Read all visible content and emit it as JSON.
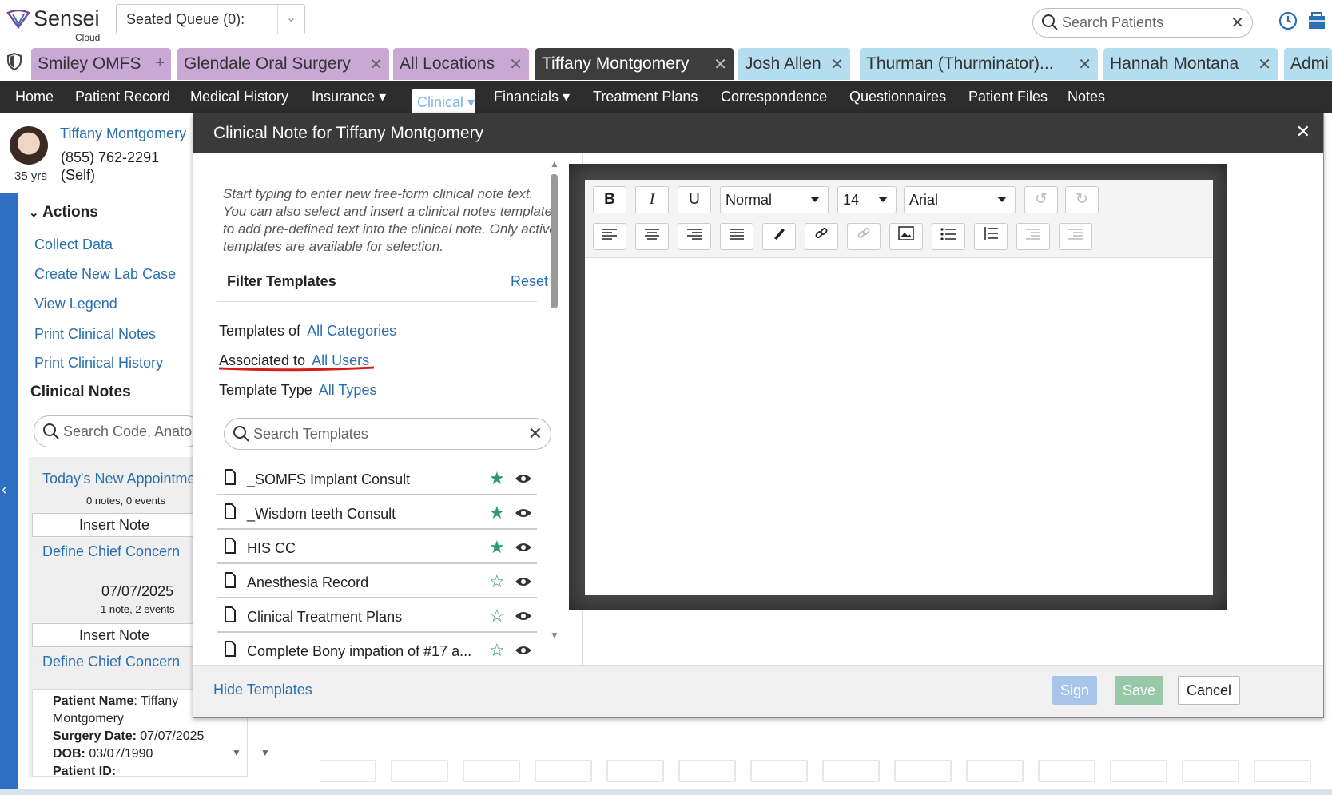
{
  "app": {
    "logo_name": "Sensei",
    "logo_sub": "Cloud"
  },
  "queue": {
    "label": "Seated Queue (0):"
  },
  "patient_search": {
    "placeholder": "Search Patients"
  },
  "tabs": [
    {
      "label": "Smiley OMFS",
      "action": "+"
    },
    {
      "label": "Glendale Oral Surgery",
      "action": "✕"
    },
    {
      "label": "All Locations",
      "action": "✕"
    },
    {
      "label": "Tiffany Montgomery",
      "action": "✕"
    },
    {
      "label": "Josh Allen",
      "action": "✕"
    },
    {
      "label": "Thurman (Thurminator)...",
      "action": "✕"
    },
    {
      "label": "Hannah Montana",
      "action": "✕"
    },
    {
      "label": "Admi",
      "action": ""
    }
  ],
  "nav": [
    "Home",
    "Patient Record",
    "Medical History",
    "Insurance",
    "Clinical",
    "Financials",
    "Treatment Plans",
    "Correspondence",
    "Questionnaires",
    "Patient Files",
    "Notes"
  ],
  "patient": {
    "name": "Tiffany Montgomery",
    "age": "35 yrs",
    "phone": "(855) 762-2291",
    "relation": "(Self)"
  },
  "actions": {
    "title": "Actions",
    "items": [
      "Collect Data",
      "Create New Lab Case",
      "View Legend",
      "Print Clinical Notes",
      "Print Clinical History"
    ]
  },
  "clinical_notes": {
    "title": "Clinical Notes",
    "search_placeholder": "Search Code, Anatomy",
    "groups": [
      {
        "title": "Today's New Appointment",
        "meta": "0 notes,  0 events",
        "insert": "Insert Note",
        "define": "Define Chief Concern"
      },
      {
        "title": "07/07/2025",
        "meta": "1 note,  2 events",
        "insert": "Insert Note",
        "define": "Define Chief Concern"
      }
    ],
    "info": {
      "name_label": "Patient Name",
      "name_value": ": Tiffany Montgomery",
      "surgery_label": "Surgery Date:",
      "surgery_value": " 07/07/2025",
      "dob_label": "DOB:",
      "dob_value": " 03/07/1990",
      "pid_label": "Patient ID:"
    }
  },
  "modal": {
    "title": "Clinical Note for Tiffany Montgomery",
    "help_text": "Start typing to enter new free-form clinical note text. You can also select and insert a clinical notes template to add pre-defined text into the clinical note. Only active templates are available for selection.",
    "filter_title": "Filter Templates",
    "reset": "Reset",
    "filters": [
      {
        "label": "Templates of",
        "value": "All Categories"
      },
      {
        "label": "Associated to",
        "value": "All Users"
      },
      {
        "label": "Template Type",
        "value": "All Types"
      }
    ],
    "template_search_placeholder": "Search Templates",
    "templates": [
      {
        "name": "_SOMFS Implant Consult",
        "starred": true
      },
      {
        "name": "_Wisdom teeth Consult",
        "starred": true
      },
      {
        "name": "HIS CC",
        "starred": true
      },
      {
        "name": "Anesthesia Record",
        "starred": false
      },
      {
        "name": "Clinical Treatment Plans",
        "starred": false
      },
      {
        "name": "Complete Bony impation of #17 a...",
        "starred": false
      }
    ],
    "editor": {
      "format": "Normal",
      "size": "14",
      "font": "Arial"
    },
    "footer": {
      "hide_templates": "Hide Templates",
      "sign": "Sign",
      "save": "Save",
      "cancel": "Cancel"
    }
  },
  "colors": {
    "nav_bg": "#2d2d2d",
    "tab_purple": "#c9a8d6",
    "tab_blue": "#b4ddef",
    "accent": "#2a6fb0",
    "star": "#2a9a6a"
  }
}
